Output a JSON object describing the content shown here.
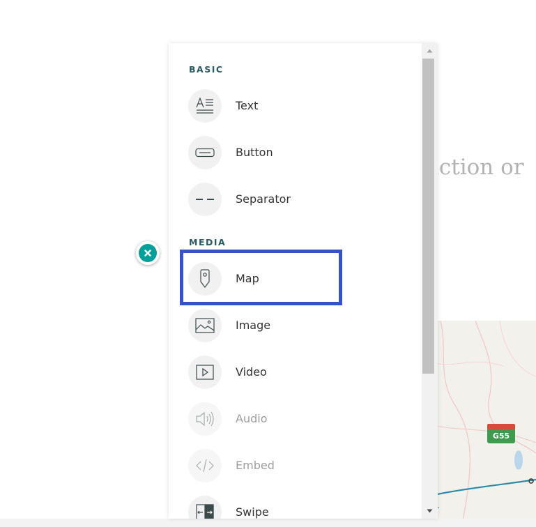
{
  "background": {
    "heading_fragment": "luction or",
    "map_shield": "G55"
  },
  "panel": {
    "sections": [
      {
        "label": "BASIC"
      },
      {
        "label": "MEDIA"
      }
    ],
    "items": [
      {
        "label": "Text",
        "icon": "text-icon",
        "enabled": true
      },
      {
        "label": "Button",
        "icon": "button-icon",
        "enabled": true
      },
      {
        "label": "Separator",
        "icon": "separator-icon",
        "enabled": true
      },
      {
        "label": "Map",
        "icon": "map-pin-icon",
        "enabled": true,
        "highlighted": true
      },
      {
        "label": "Image",
        "icon": "image-icon",
        "enabled": true
      },
      {
        "label": "Video",
        "icon": "video-icon",
        "enabled": true
      },
      {
        "label": "Audio",
        "icon": "audio-icon",
        "enabled": false
      },
      {
        "label": "Embed",
        "icon": "embed-icon",
        "enabled": false
      },
      {
        "label": "Swipe",
        "icon": "swipe-icon",
        "enabled": true
      }
    ]
  },
  "colors": {
    "accent_teal": "#00a09a",
    "section_label": "#2b5a61",
    "highlight_border": "#3652c8"
  }
}
